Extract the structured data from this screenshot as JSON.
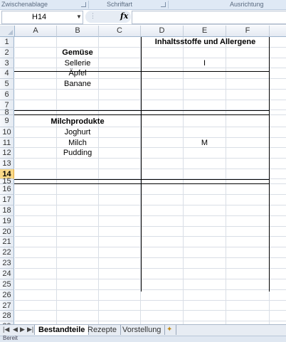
{
  "ribbon": {
    "groups": [
      "Zwischenablage",
      "Schriftart",
      "Ausrichtung"
    ]
  },
  "formula_bar": {
    "name_box": "H14",
    "fx_label": "fx",
    "formula": ""
  },
  "columns": [
    "A",
    "B",
    "C",
    "D",
    "E",
    "F"
  ],
  "rows": [
    "1",
    "2",
    "3",
    "4",
    "5",
    "6",
    "7",
    "8",
    "9",
    "10",
    "11",
    "12",
    "13",
    "14",
    "15",
    "16",
    "17",
    "18",
    "19",
    "20",
    "21",
    "22",
    "23",
    "24",
    "25",
    "26",
    "27",
    "28",
    "29"
  ],
  "active_row": "14",
  "cells": {
    "header_title": "Inhaltsstoffe und Allergene",
    "veg_title": "Gemüse",
    "veg_1": "Sellerie",
    "veg_1_code": "I",
    "veg_2": "Äpfel",
    "veg_3": "Banane",
    "dairy_title": "Milchprodukte",
    "dairy_1": "Joghurt",
    "dairy_2": "Milch",
    "dairy_2_code": "M",
    "dairy_3": "Pudding"
  },
  "sheet_tabs": [
    "Bestandteile",
    "Rezepte",
    "Vorstellung"
  ],
  "active_tab": "Bestandteile",
  "status": "Bereit"
}
